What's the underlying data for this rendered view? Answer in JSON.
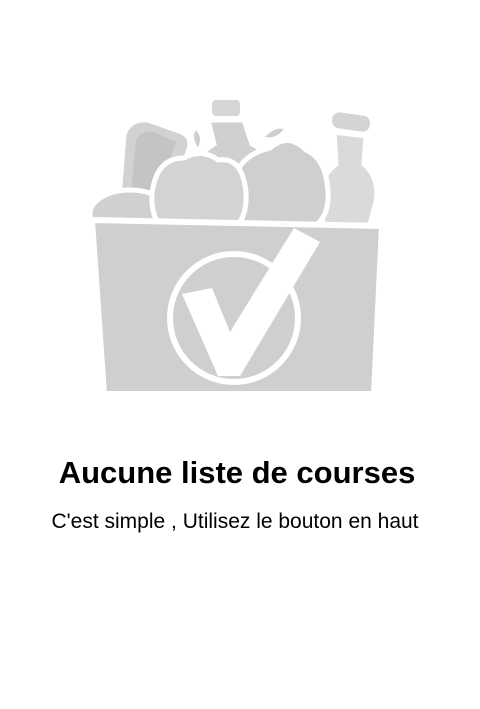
{
  "empty_state": {
    "illustration_icon": "grocery-bag-check-icon",
    "title": "Aucune liste de courses",
    "subtitle": "C'est simple , Utilisez le bouton en haut"
  },
  "colors": {
    "background": "#ffffff",
    "illustration_gray": "#cfcfcf",
    "illustration_light": "#e6e6e6",
    "text": "#000000"
  }
}
